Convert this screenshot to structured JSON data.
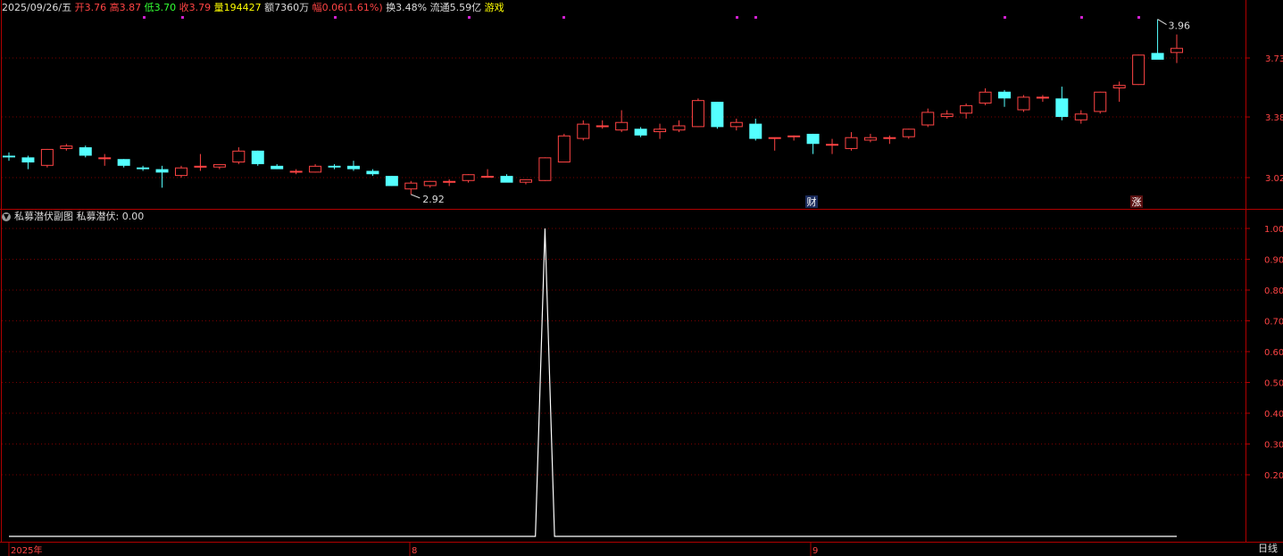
{
  "header": {
    "date": "2025/09/26/五",
    "open_label": "开",
    "open": "3.76",
    "high_label": "高",
    "high": "3.87",
    "low_label": "低",
    "low": "3.70",
    "close_label": "收",
    "close": "3.79",
    "volume_label": "量",
    "volume": "194427",
    "amount_label": "额",
    "amount": "7360万",
    "change_label": "幅",
    "change": "0.06(1.61%)",
    "turnover_label": "换",
    "turnover": "3.48%",
    "float_label": "流通",
    "float": "5.59亿",
    "sector": "游戏"
  },
  "main_chart": {
    "y_ticks": [
      "3.73",
      "3.38",
      "3.02"
    ],
    "high_marker": "3.96",
    "low_marker": "2.92",
    "badges": [
      "财",
      "涨"
    ]
  },
  "indicator": {
    "panel_title": "私募潜伏副图",
    "series_label": "私募潜伏: 0.00",
    "y_ticks": [
      "1.00",
      "0.90",
      "0.80",
      "0.70",
      "0.60",
      "0.50",
      "0.40",
      "0.30",
      "0.20"
    ]
  },
  "x_axis": {
    "labels": [
      "2025年",
      "8",
      "9"
    ]
  },
  "period": "日线",
  "colors": {
    "up": "#ff4444",
    "down": "#54ffff",
    "axis": "#b00000",
    "indicator_line": "#ffffff"
  },
  "chart_data": [
    {
      "type": "candlestick",
      "ylim": [
        2.92,
        3.96
      ],
      "y_ticks": [
        3.02,
        3.38,
        3.73
      ],
      "candles": [
        {
          "o": 3.15,
          "h": 3.17,
          "l": 3.12,
          "c": 3.14
        },
        {
          "o": 3.14,
          "h": 3.15,
          "l": 3.07,
          "c": 3.11
        },
        {
          "o": 3.09,
          "h": 3.19,
          "l": 3.08,
          "c": 3.19
        },
        {
          "o": 3.19,
          "h": 3.22,
          "l": 3.18,
          "c": 3.21
        },
        {
          "o": 3.2,
          "h": 3.21,
          "l": 3.14,
          "c": 3.15
        },
        {
          "o": 3.14,
          "h": 3.16,
          "l": 3.09,
          "c": 3.14
        },
        {
          "o": 3.13,
          "h": 3.13,
          "l": 3.08,
          "c": 3.09
        },
        {
          "o": 3.08,
          "h": 3.09,
          "l": 3.06,
          "c": 3.07
        },
        {
          "o": 3.07,
          "h": 3.09,
          "l": 2.96,
          "c": 3.05
        },
        {
          "o": 3.03,
          "h": 3.09,
          "l": 3.02,
          "c": 3.08
        },
        {
          "o": 3.08,
          "h": 3.16,
          "l": 3.06,
          "c": 3.09
        },
        {
          "o": 3.08,
          "h": 3.1,
          "l": 3.07,
          "c": 3.1
        },
        {
          "o": 3.11,
          "h": 3.2,
          "l": 3.1,
          "c": 3.18
        },
        {
          "o": 3.18,
          "h": 3.18,
          "l": 3.09,
          "c": 3.1
        },
        {
          "o": 3.09,
          "h": 3.1,
          "l": 3.07,
          "c": 3.07
        },
        {
          "o": 3.05,
          "h": 3.07,
          "l": 3.04,
          "c": 3.06
        },
        {
          "o": 3.05,
          "h": 3.1,
          "l": 3.05,
          "c": 3.09
        },
        {
          "o": 3.09,
          "h": 3.1,
          "l": 3.07,
          "c": 3.08
        },
        {
          "o": 3.09,
          "h": 3.12,
          "l": 3.06,
          "c": 3.07
        },
        {
          "o": 3.06,
          "h": 3.07,
          "l": 3.03,
          "c": 3.04
        },
        {
          "o": 3.03,
          "h": 3.03,
          "l": 2.97,
          "c": 2.97
        },
        {
          "o": 2.95,
          "h": 3.0,
          "l": 2.92,
          "c": 2.99
        },
        {
          "o": 2.97,
          "h": 3.0,
          "l": 2.96,
          "c": 3.0
        },
        {
          "o": 3.0,
          "h": 3.01,
          "l": 2.97,
          "c": 3.0
        },
        {
          "o": 3.0,
          "h": 3.04,
          "l": 2.99,
          "c": 3.04
        },
        {
          "o": 3.03,
          "h": 3.07,
          "l": 3.02,
          "c": 3.03
        },
        {
          "o": 3.03,
          "h": 3.04,
          "l": 3.0,
          "c": 2.99
        },
        {
          "o": 2.99,
          "h": 3.01,
          "l": 2.98,
          "c": 3.01
        },
        {
          "o": 3.0,
          "h": 3.14,
          "l": 3.0,
          "c": 3.14
        },
        {
          "o": 3.11,
          "h": 3.28,
          "l": 3.11,
          "c": 3.27
        },
        {
          "o": 3.25,
          "h": 3.36,
          "l": 3.24,
          "c": 3.34
        },
        {
          "o": 3.33,
          "h": 3.36,
          "l": 3.31,
          "c": 3.33
        },
        {
          "o": 3.3,
          "h": 3.42,
          "l": 3.29,
          "c": 3.35
        },
        {
          "o": 3.31,
          "h": 3.32,
          "l": 3.26,
          "c": 3.27
        },
        {
          "o": 3.29,
          "h": 3.34,
          "l": 3.25,
          "c": 3.31
        },
        {
          "o": 3.3,
          "h": 3.36,
          "l": 3.29,
          "c": 3.33
        },
        {
          "o": 3.32,
          "h": 3.49,
          "l": 3.32,
          "c": 3.48
        },
        {
          "o": 3.47,
          "h": 3.47,
          "l": 3.31,
          "c": 3.32
        },
        {
          "o": 3.32,
          "h": 3.37,
          "l": 3.3,
          "c": 3.35
        },
        {
          "o": 3.34,
          "h": 3.37,
          "l": 3.24,
          "c": 3.25
        },
        {
          "o": 3.25,
          "h": 3.25,
          "l": 3.18,
          "c": 3.26
        },
        {
          "o": 3.26,
          "h": 3.27,
          "l": 3.24,
          "c": 3.27
        },
        {
          "o": 3.28,
          "h": 3.28,
          "l": 3.16,
          "c": 3.22
        },
        {
          "o": 3.22,
          "h": 3.25,
          "l": 3.16,
          "c": 3.22
        },
        {
          "o": 3.19,
          "h": 3.29,
          "l": 3.18,
          "c": 3.26
        },
        {
          "o": 3.24,
          "h": 3.28,
          "l": 3.23,
          "c": 3.26
        },
        {
          "o": 3.25,
          "h": 3.27,
          "l": 3.22,
          "c": 3.26
        },
        {
          "o": 3.26,
          "h": 3.31,
          "l": 3.25,
          "c": 3.31
        },
        {
          "o": 3.33,
          "h": 3.43,
          "l": 3.32,
          "c": 3.41
        },
        {
          "o": 3.38,
          "h": 3.42,
          "l": 3.37,
          "c": 3.4
        },
        {
          "o": 3.4,
          "h": 3.46,
          "l": 3.37,
          "c": 3.45
        },
        {
          "o": 3.46,
          "h": 3.55,
          "l": 3.45,
          "c": 3.53
        },
        {
          "o": 3.53,
          "h": 3.54,
          "l": 3.44,
          "c": 3.49
        },
        {
          "o": 3.42,
          "h": 3.51,
          "l": 3.41,
          "c": 3.5
        },
        {
          "o": 3.5,
          "h": 3.51,
          "l": 3.47,
          "c": 3.5
        },
        {
          "o": 3.49,
          "h": 3.56,
          "l": 3.36,
          "c": 3.38
        },
        {
          "o": 3.36,
          "h": 3.42,
          "l": 3.34,
          "c": 3.4
        },
        {
          "o": 3.41,
          "h": 3.53,
          "l": 3.4,
          "c": 3.53
        },
        {
          "o": 3.55,
          "h": 3.59,
          "l": 3.47,
          "c": 3.57
        },
        {
          "o": 3.57,
          "h": 3.75,
          "l": 3.57,
          "c": 3.75
        },
        {
          "o": 3.76,
          "h": 3.96,
          "l": 3.73,
          "c": 3.72
        },
        {
          "o": 3.76,
          "h": 3.87,
          "l": 3.7,
          "c": 3.79
        }
      ]
    },
    {
      "type": "line",
      "name": "私募潜伏",
      "ylim": [
        0,
        1.0
      ],
      "peak": 1.0,
      "values": [
        0,
        0,
        0,
        0,
        0,
        0,
        0,
        0,
        0,
        0,
        0,
        0,
        0,
        0,
        0,
        0,
        0,
        0,
        0,
        0,
        0,
        0,
        0,
        0,
        0,
        0,
        0,
        0,
        1,
        0,
        0,
        0,
        0,
        0,
        0,
        0,
        0,
        0,
        0,
        0,
        0,
        0,
        0,
        0,
        0,
        0,
        0,
        0,
        0,
        0,
        0,
        0,
        0,
        0,
        0,
        0,
        0,
        0,
        0,
        0,
        0,
        0
      ]
    }
  ]
}
